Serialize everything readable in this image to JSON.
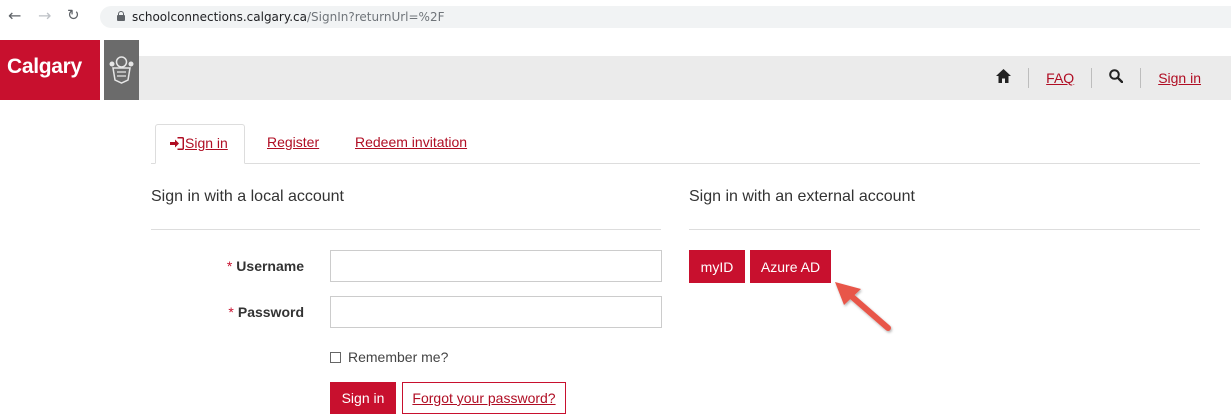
{
  "browser": {
    "back_icon": "arrow-left-icon",
    "forward_icon": "arrow-right-icon",
    "reload_icon": "reload-icon",
    "url_host": "schoolconnections.calgary.ca",
    "url_path": "/SignIn?returnUrl=%2F"
  },
  "header": {
    "brand": "Calgary",
    "nav": {
      "faq": "FAQ",
      "sign_in": "Sign in"
    }
  },
  "tabs": [
    {
      "label": "Sign in",
      "active": true
    },
    {
      "label": "Register",
      "active": false
    },
    {
      "label": "Redeem invitation",
      "active": false
    }
  ],
  "local": {
    "title": "Sign in with a local account",
    "username_label": "Username",
    "password_label": "Password",
    "required_mark": "*",
    "username_value": "",
    "password_value": "",
    "remember_label": "Remember me?",
    "signin_button": "Sign in",
    "forgot_link": "Forgot your password?"
  },
  "external": {
    "title": "Sign in with an external account",
    "providers": [
      "myID",
      "Azure AD"
    ]
  },
  "colors": {
    "brand_red": "#c8102e",
    "link_red": "#b00d23",
    "arrow": "#e8574a"
  }
}
